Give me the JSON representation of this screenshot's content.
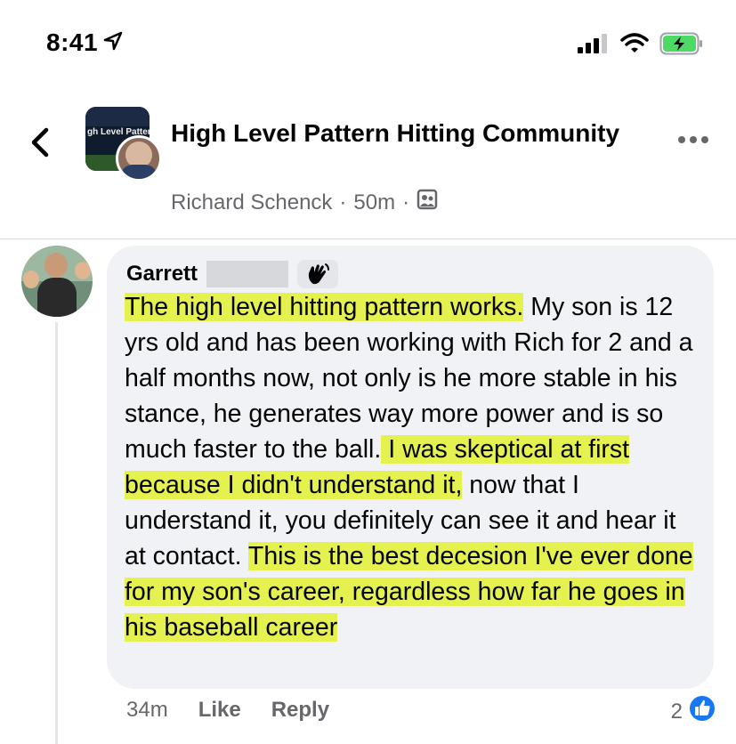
{
  "status_bar": {
    "time": "8:41",
    "icons": [
      "location-arrow-icon",
      "signal-icon",
      "wifi-icon",
      "battery-charging-icon"
    ],
    "battery_color": "#4cd964"
  },
  "header": {
    "group_name": "High Level Pattern Hitting Community",
    "group_avatar_text": "gh Level Patter tting Co",
    "author": "Richard Schenck",
    "separator": "·",
    "time_ago": "50m",
    "audience_icon": "group-members-icon",
    "more_icon": "more-dots-icon",
    "back_icon": "chevron-left-icon"
  },
  "comment": {
    "author": "Garrett",
    "badge_icon": "waving-hand-icon",
    "segments": [
      {
        "text": "The high level hitting pattern works.",
        "highlight": true
      },
      {
        "text": " My son is 12 yrs old and has been working with Rich for 2 and a half months now, not only is he more stable in his stance, he generates way more power and is so much faster to the ball.",
        "highlight": false
      },
      {
        "text": " I was skeptical at first because I didn't understand it,",
        "highlight": true
      },
      {
        "text": " now that I understand it, you definitely can see it and hear it at contact. ",
        "highlight": false
      },
      {
        "text": "This is the best decesion I've ever done for my son's career, regardless how far he goes in his baseball career",
        "highlight": true
      }
    ],
    "highlight_color": "#e4f14f",
    "time_ago": "34m",
    "like_label": "Like",
    "reply_label": "Reply",
    "reaction_count": "2",
    "reaction_icon": "like-thumb-icon",
    "reaction_color": "#1877f2"
  }
}
